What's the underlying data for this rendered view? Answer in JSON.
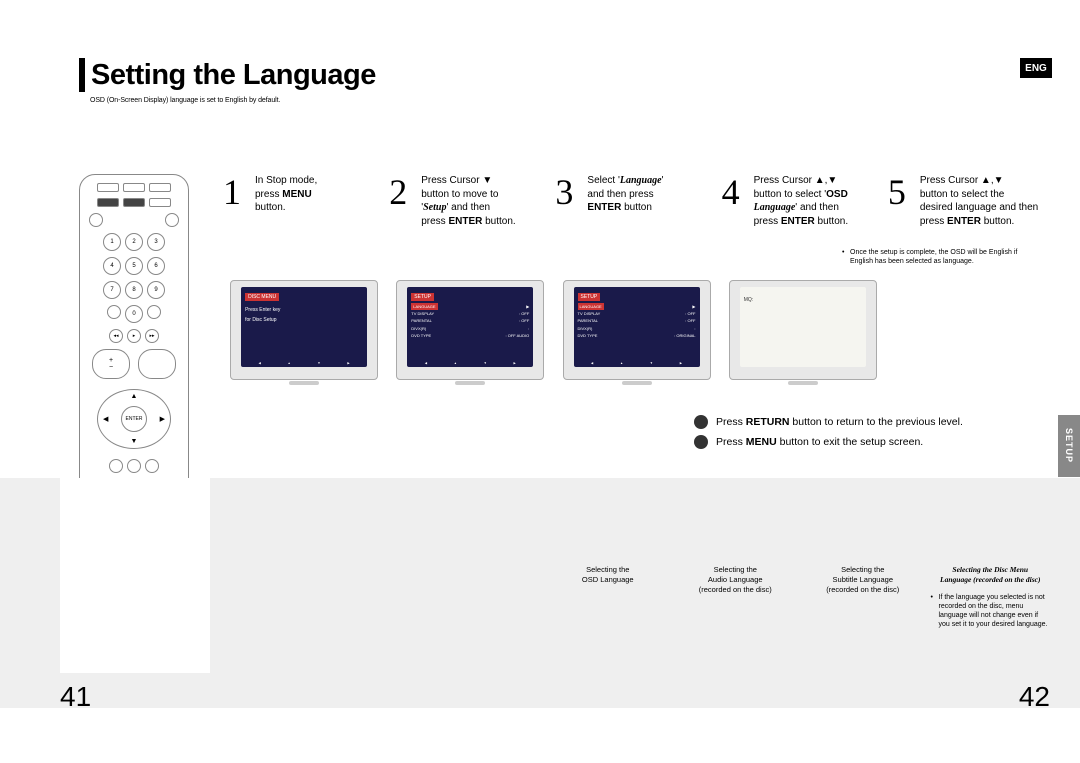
{
  "title": "Setting the Language",
  "lang_badge": "ENG",
  "subtitle": "OSD (On-Screen Display) language is set to English by default.",
  "steps": [
    {
      "num": "1",
      "lines": [
        "In Stop mode,",
        "press <b>MENU</b>",
        "button."
      ],
      "screen": {
        "title": "DISC MENU",
        "body": [
          "Press Enter key",
          "for Disc Setup"
        ],
        "footer": [
          "",
          "",
          "",
          ""
        ]
      }
    },
    {
      "num": "2",
      "lines": [
        "Press Cursor ▼",
        "button to move to",
        "'<b class=it>Setup</b>' and then",
        "press <b>ENTER</b> button."
      ],
      "screen": {
        "title": "SETUP",
        "rows": [
          [
            "LANGUAGE",
            "▶"
          ],
          [
            "TV DISPLAY",
            ": OFF"
          ],
          [
            "PARENTAL",
            ": OFF"
          ],
          [
            "DIVX(R)",
            ":"
          ],
          [
            "DVD TYPE",
            ": OFF AUDIO"
          ]
        ],
        "footer": [
          "",
          "",
          "",
          ""
        ],
        "hi": 0
      }
    },
    {
      "num": "3",
      "lines": [
        "Select '<b class=it>Language</b>'",
        "and then press",
        "<b>ENTER</b> button"
      ],
      "screen": {
        "title": "SETUP",
        "rows": [
          [
            "LANGUAGE",
            "▶"
          ],
          [
            "TV DISPLAY",
            ": OFF"
          ],
          [
            "PARENTAL",
            ": OFF"
          ],
          [
            "DIVX(R)",
            ":"
          ],
          [
            "DVD TYPE",
            ": ORIGINAL"
          ]
        ],
        "footer": [
          "",
          "",
          "",
          ""
        ],
        "hi": 0
      }
    },
    {
      "num": "4",
      "lines": [
        "Press Cursor ▲,▼",
        "button to select '<b>OSD</b>",
        "<b class=it>Language</b>' and then",
        "press <b>ENTER</b> button."
      ],
      "screen": {
        "light": true,
        "body": [
          "MQ:"
        ]
      }
    },
    {
      "num": "5",
      "lines": [
        "Press Cursor ▲,▼",
        "button to select the",
        "desired language and then",
        "press <b>ENTER</b> button."
      ],
      "screen": null
    }
  ],
  "note_lines": [
    "Once the setup is complete, the OSD will be",
    "English if English has been selected as language."
  ],
  "hints": [
    "Press <b>RETURN</b> button to return to the previous level.",
    "Press <b>MENU</b> button to exit the setup screen."
  ],
  "setup_tab": "SETUP",
  "footer_cols": [
    {
      "l1": "Selecting the",
      "l2": "OSD Language"
    },
    {
      "l1": "Selecting the",
      "l2": "Audio Language",
      "l3": "(recorded on the disc)"
    },
    {
      "l1": "Selecting the",
      "l2": "Subtitle Language",
      "l3": "(recorded on the disc)"
    },
    {
      "it1": "Selecting the Disc Menu",
      "it2": "Language (recorded on the disc)",
      "note": "If the language you selected is not recorded on the disc, menu language will not change even if you set it to your desired language."
    }
  ],
  "page_left": "41",
  "page_right": "42",
  "remote": {
    "nums": [
      "1",
      "2",
      "3",
      "4",
      "5",
      "6",
      "7",
      "8",
      "9",
      "0"
    ],
    "enter": "ENTER"
  }
}
